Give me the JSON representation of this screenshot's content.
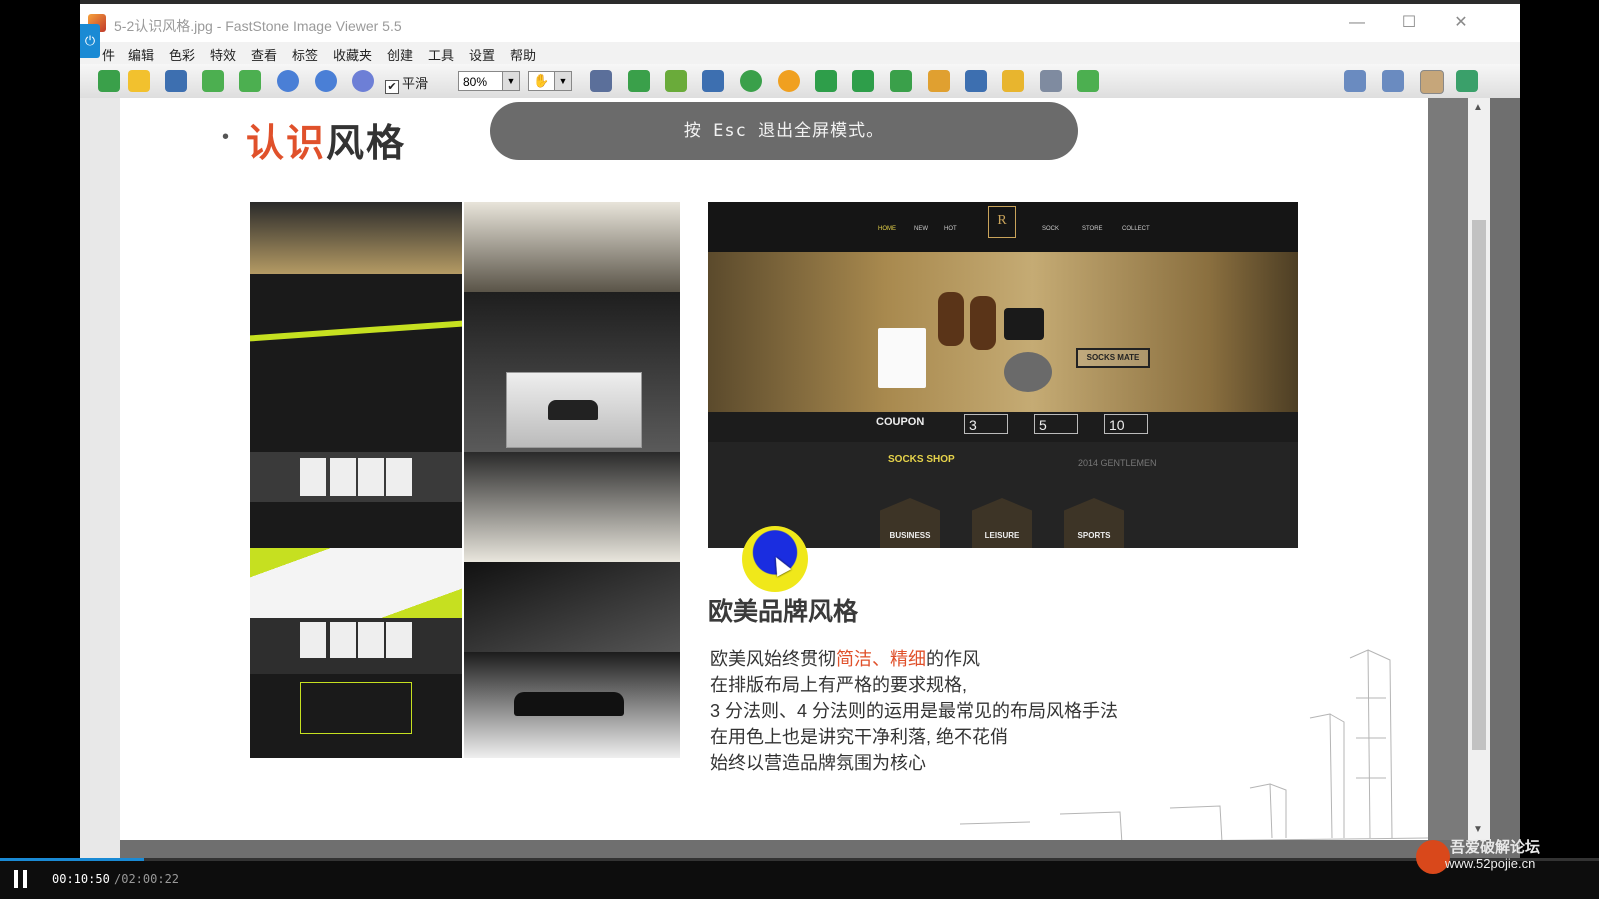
{
  "window": {
    "title": "5-2认识风格.jpg - FastStone Image Viewer 5.5",
    "minimize": "—",
    "maximize": "☐",
    "close": "✕"
  },
  "menu": [
    "件",
    "编辑",
    "色彩",
    "特效",
    "查看",
    "标签",
    "收藏夹",
    "创建",
    "工具",
    "设置",
    "帮助"
  ],
  "toolbar": {
    "smooth_label": "平滑",
    "smooth_checked": "✔",
    "zoom_value": "80%"
  },
  "banner": "按 Esc 退出全屏模式。",
  "slide": {
    "bullet": "•",
    "heading_red": "认识",
    "heading_dark": "风格",
    "brand": {
      "logo": "R",
      "nav": [
        "HOME",
        "NEW",
        "HOT",
        "SOCK",
        "STORE",
        "COLLECT"
      ],
      "socks_mate": "SOCKS MATE",
      "coupon": "COUPON",
      "coupon_values": [
        "3",
        "5",
        "10"
      ],
      "socks_shop": "SOCKS SHOP",
      "gentlemen": "2014 GENTLEMEN",
      "categories": [
        "BUSINESS",
        "LEISURE",
        "SPORTS"
      ]
    },
    "style_title": "欧美品牌风格",
    "desc": {
      "line1_pre": "欧美风始终贯彻",
      "line1_hl1": "简洁",
      "line1_sep": "、",
      "line1_hl2": "精细",
      "line1_post": "的作风",
      "line2": "在排版布局上有严格的要求规格,",
      "line3": "3 分法则、4 分法则的运用是最常见的布局风格手法",
      "line4": "在用色上也是讲究干净利落, 绝不花俏",
      "line5": "始终以营造品牌氛围为核心"
    }
  },
  "player": {
    "current_time": "00:10:50",
    "total_time": "/02:00:22",
    "progress": 0.09
  },
  "watermark": {
    "title": "吾爱破解论坛",
    "url": "www.52pojie.cn"
  },
  "colors": {
    "accent_red": "#e0512b",
    "player_blue": "#1a8ad4"
  }
}
